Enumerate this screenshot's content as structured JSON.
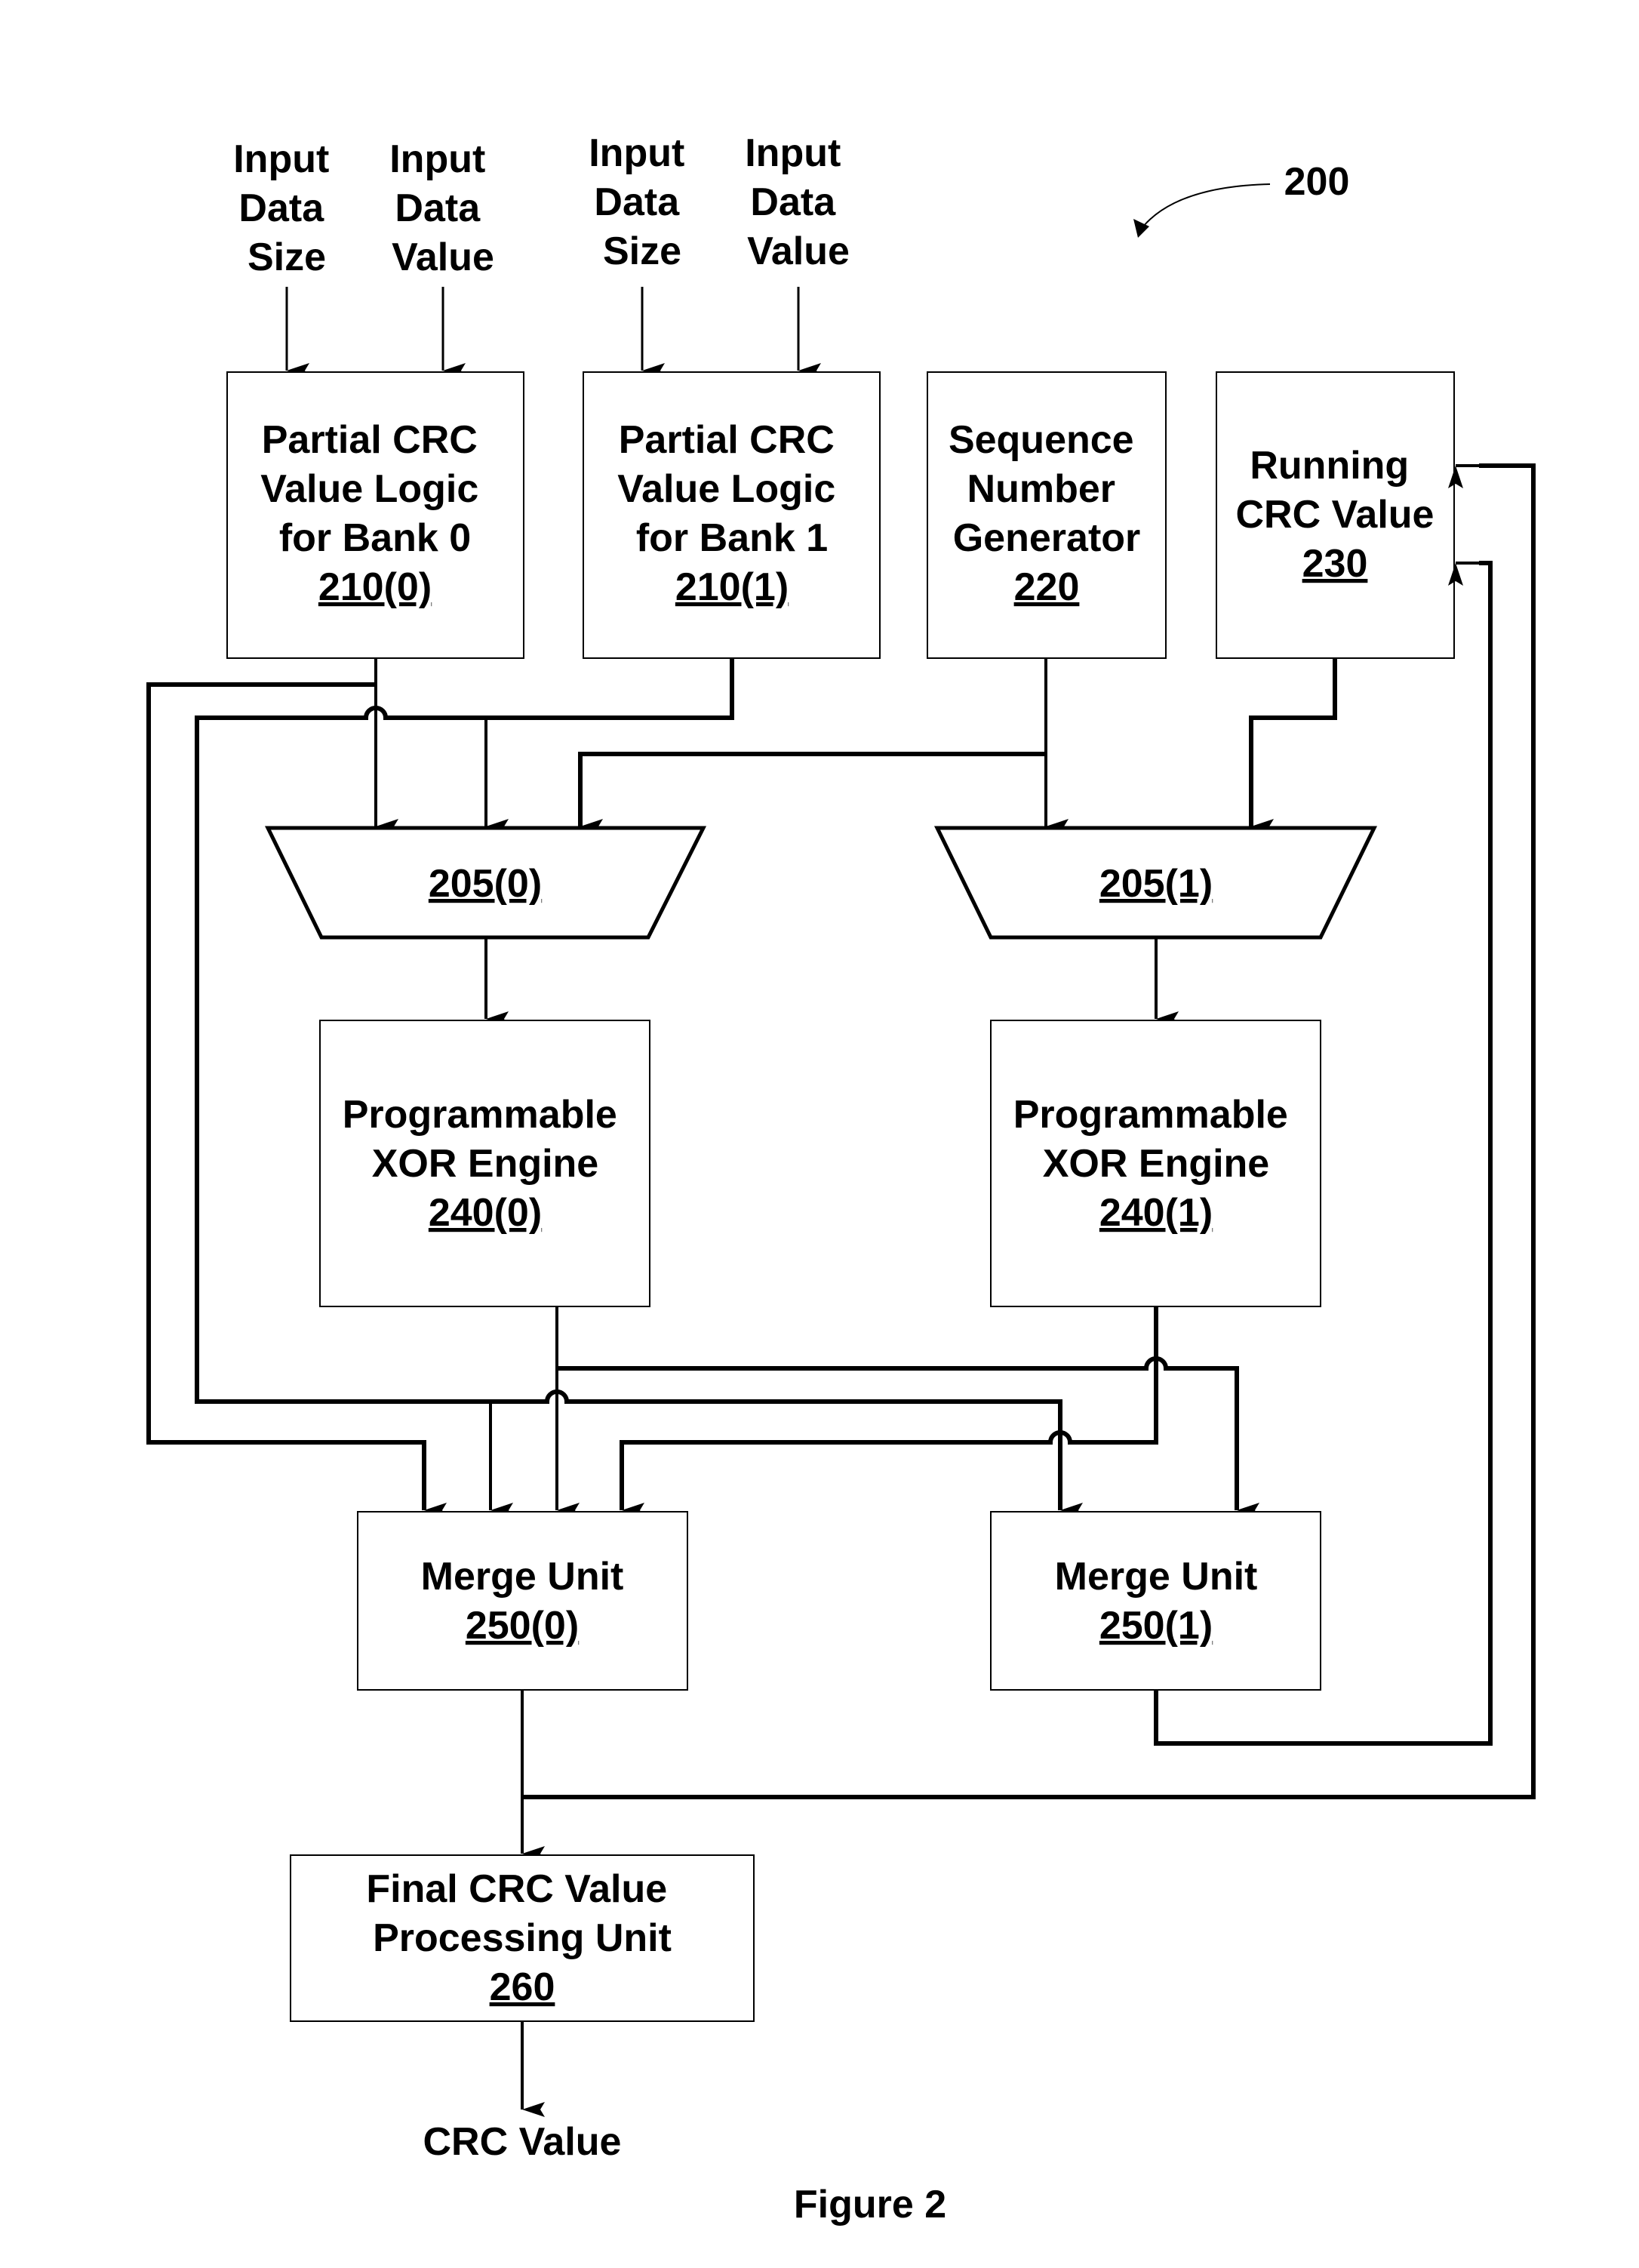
{
  "figure": {
    "reference_number": "200",
    "caption": "Figure 2",
    "colors": {
      "line": "#000000",
      "background": "#ffffff"
    }
  },
  "inputs": [
    {
      "lines": [
        "Input",
        "Data",
        "Size"
      ],
      "target": "210(0)"
    },
    {
      "lines": [
        "Input",
        "Data",
        "Value"
      ],
      "target": "210(0)"
    },
    {
      "lines": [
        "Input",
        "Data",
        "Size"
      ],
      "target": "210(1)"
    },
    {
      "lines": [
        "Input",
        "Data",
        "Value"
      ],
      "target": "210(1)"
    }
  ],
  "blocks": {
    "partial_crc_bank0": {
      "lines": [
        "Partial CRC",
        "Value Logic",
        "for Bank 0"
      ],
      "ref": "210(0)"
    },
    "partial_crc_bank1": {
      "lines": [
        "Partial CRC",
        "Value Logic",
        "for Bank 1"
      ],
      "ref": "210(1)"
    },
    "sequence_number_generator": {
      "lines": [
        "Sequence",
        "Number",
        "Generator"
      ],
      "ref": "220"
    },
    "running_crc_value": {
      "lines": [
        "Running",
        "CRC Value"
      ],
      "ref": "230"
    },
    "mux0": {
      "ref": "205(0)"
    },
    "mux1": {
      "ref": "205(1)"
    },
    "xor_engine0": {
      "lines": [
        "Programmable",
        "XOR Engine"
      ],
      "ref": "240(0)"
    },
    "xor_engine1": {
      "lines": [
        "Programmable",
        "XOR Engine"
      ],
      "ref": "240(1)"
    },
    "merge_unit0": {
      "lines": [
        "Merge Unit"
      ],
      "ref": "250(0)"
    },
    "merge_unit1": {
      "lines": [
        "Merge Unit"
      ],
      "ref": "250(1)"
    },
    "final_crc_unit": {
      "lines": [
        "Final CRC Value",
        "Processing Unit"
      ],
      "ref": "260"
    }
  },
  "output": {
    "label": "CRC Value"
  },
  "connections": [
    {
      "from": "Input Data Size",
      "to": "210(0)"
    },
    {
      "from": "Input Data Value",
      "to": "210(0)"
    },
    {
      "from": "Input Data Size",
      "to": "210(1)"
    },
    {
      "from": "Input Data Value",
      "to": "210(1)"
    },
    {
      "from": "210(0)",
      "to": "205(0)"
    },
    {
      "from": "210(0)",
      "to": "250(0)"
    },
    {
      "from": "210(1)",
      "to": "205(0)"
    },
    {
      "from": "210(1)",
      "to": "250(0)"
    },
    {
      "from": "210(1)",
      "to": "250(1)"
    },
    {
      "from": "220",
      "to": "205(0)"
    },
    {
      "from": "220",
      "to": "205(1)"
    },
    {
      "from": "230",
      "to": "205(1)"
    },
    {
      "from": "205(0)",
      "to": "240(0)"
    },
    {
      "from": "205(1)",
      "to": "240(1)"
    },
    {
      "from": "240(0)",
      "to": "250(0)"
    },
    {
      "from": "240(0)",
      "to": "250(1)"
    },
    {
      "from": "240(1)",
      "to": "250(0)"
    },
    {
      "from": "250(0)",
      "to": "260"
    },
    {
      "from": "250(0)",
      "to": "230"
    },
    {
      "from": "250(1)",
      "to": "230"
    },
    {
      "from": "260",
      "to": "CRC Value"
    }
  ]
}
